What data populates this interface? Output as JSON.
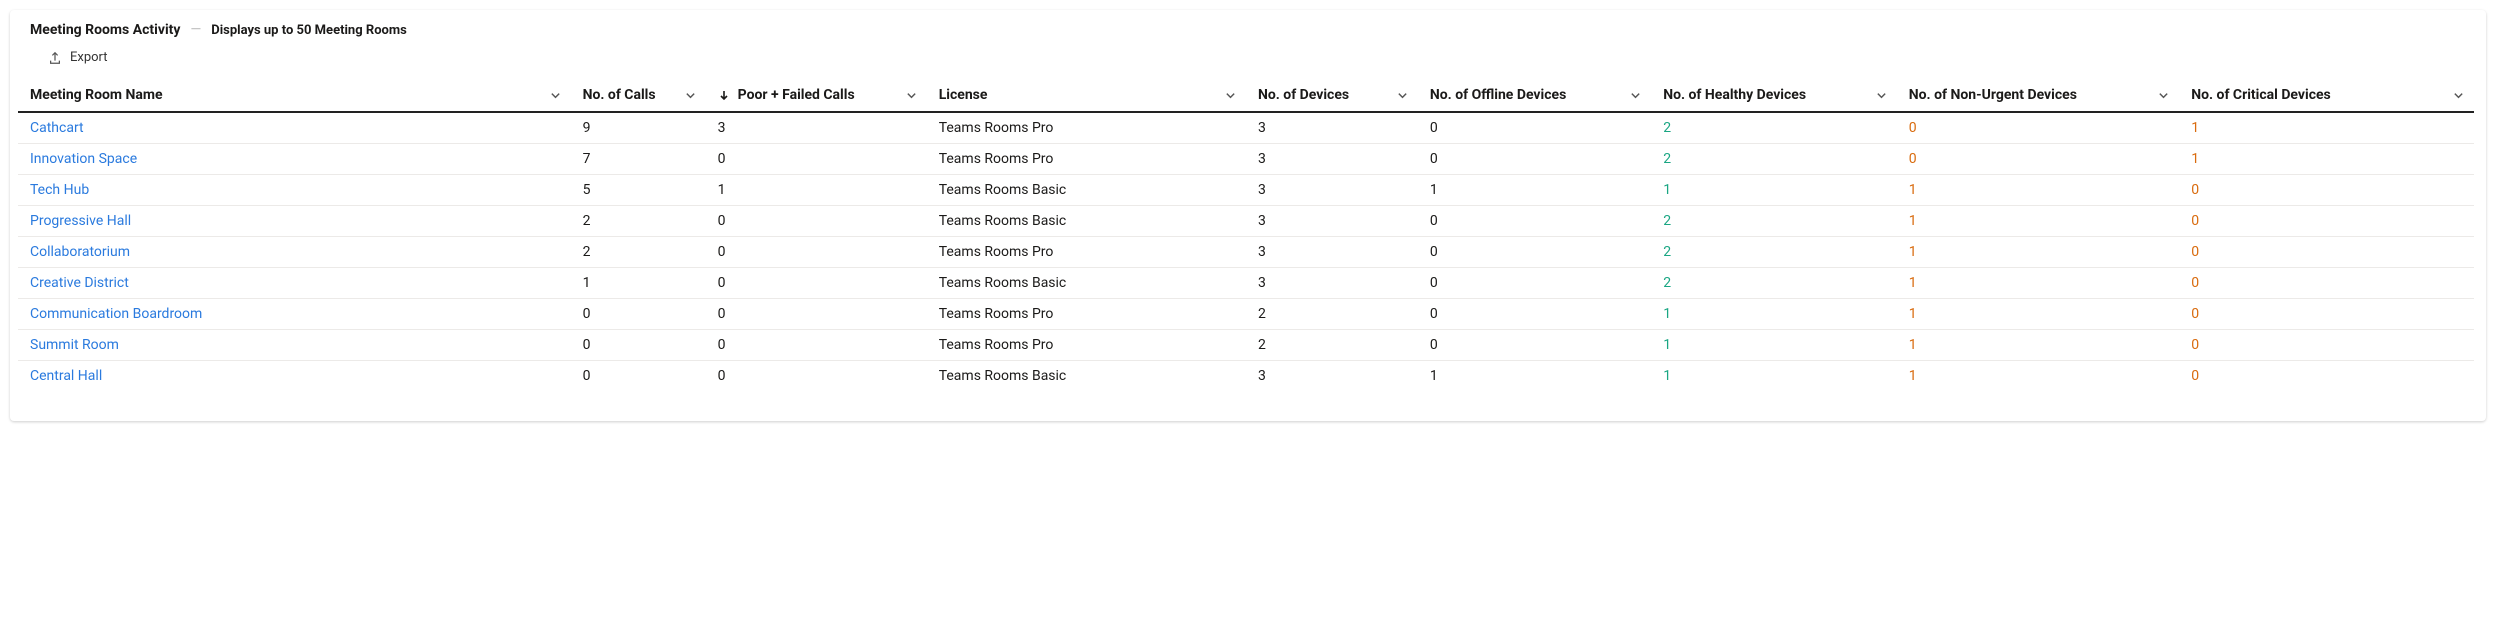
{
  "header": {
    "title": "Meeting Rooms Activity",
    "dash": "—",
    "subtitle": "Displays up to 50 Meeting Rooms"
  },
  "toolbar": {
    "export_label": "Export"
  },
  "columns": {
    "name": "Meeting Room Name",
    "calls": "No. of Calls",
    "poor": "Poor + Failed Calls",
    "license": "License",
    "devices": "No. of Devices",
    "offline": "No. of Offline Devices",
    "healthy": "No. of Healthy Devices",
    "nonurgent": "No. of Non-Urgent Devices",
    "critical": "No. of Critical Devices"
  },
  "sort": {
    "column": "poor",
    "direction": "desc"
  },
  "rows": [
    {
      "name": "Cathcart",
      "calls": "9",
      "poor": "3",
      "license": "Teams Rooms Pro",
      "devices": "3",
      "offline": "0",
      "healthy": "2",
      "nonurgent": "0",
      "critical": "1"
    },
    {
      "name": "Innovation Space",
      "calls": "7",
      "poor": "0",
      "license": "Teams Rooms Pro",
      "devices": "3",
      "offline": "0",
      "healthy": "2",
      "nonurgent": "0",
      "critical": "1"
    },
    {
      "name": "Tech Hub",
      "calls": "5",
      "poor": "1",
      "license": "Teams Rooms Basic",
      "devices": "3",
      "offline": "1",
      "healthy": "1",
      "nonurgent": "1",
      "critical": "0"
    },
    {
      "name": "Progressive Hall",
      "calls": "2",
      "poor": "0",
      "license": "Teams Rooms Basic",
      "devices": "3",
      "offline": "0",
      "healthy": "2",
      "nonurgent": "1",
      "critical": "0"
    },
    {
      "name": "Collaboratorium",
      "calls": "2",
      "poor": "0",
      "license": "Teams Rooms Pro",
      "devices": "3",
      "offline": "0",
      "healthy": "2",
      "nonurgent": "1",
      "critical": "0"
    },
    {
      "name": "Creative District",
      "calls": "1",
      "poor": "0",
      "license": "Teams Rooms Basic",
      "devices": "3",
      "offline": "0",
      "healthy": "2",
      "nonurgent": "1",
      "critical": "0"
    },
    {
      "name": "Communication Boardroom",
      "calls": "0",
      "poor": "0",
      "license": "Teams Rooms Pro",
      "devices": "2",
      "offline": "0",
      "healthy": "1",
      "nonurgent": "1",
      "critical": "0"
    },
    {
      "name": "Summit Room",
      "calls": "0",
      "poor": "0",
      "license": "Teams Rooms Pro",
      "devices": "2",
      "offline": "0",
      "healthy": "1",
      "nonurgent": "1",
      "critical": "0"
    },
    {
      "name": "Central Hall",
      "calls": "0",
      "poor": "0",
      "license": "Teams Rooms Basic",
      "devices": "3",
      "offline": "1",
      "healthy": "1",
      "nonurgent": "1",
      "critical": "0"
    }
  ]
}
